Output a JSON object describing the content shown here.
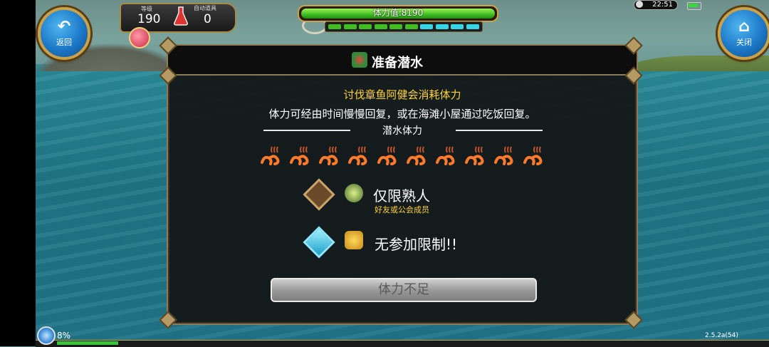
{
  "hud": {
    "back": {
      "icon": "back-arrow-icon",
      "label": "返回"
    },
    "close": {
      "icon": "house-icon",
      "label": "关闭"
    },
    "level": {
      "label": "等级",
      "value": "190"
    },
    "auto_item": {
      "label": "自动道具",
      "value": "0"
    },
    "stamina": {
      "text": "体力值:8190",
      "fill_fraction": 1.0
    },
    "time": "22:51",
    "segments": [
      "green",
      "green",
      "green",
      "green",
      "green",
      "green",
      "cyan",
      "cyan",
      "cyan",
      "cyan"
    ],
    "bottom_percent": "8%",
    "version": "2.5.2a(54)"
  },
  "dialog": {
    "title": "准备潜水",
    "warning": "讨伐章鱼阿健会消耗体力",
    "description": "体力可经由时间慢慢回复，或在海滩小屋通过吃饭回复。",
    "section_label": "潜水体力",
    "stamina_icons_count": 10,
    "option_friends": {
      "title": "仅限熟人",
      "subtitle": "好友或公会成员"
    },
    "option_open": {
      "title": "无参加限制!!"
    },
    "action_button": "体力不足"
  },
  "colors": {
    "accent_gold": "#c9a24a",
    "warning_yellow": "#ffd338",
    "stamina_green": "#3fbd22",
    "segment_cyan": "#36d6e6"
  }
}
